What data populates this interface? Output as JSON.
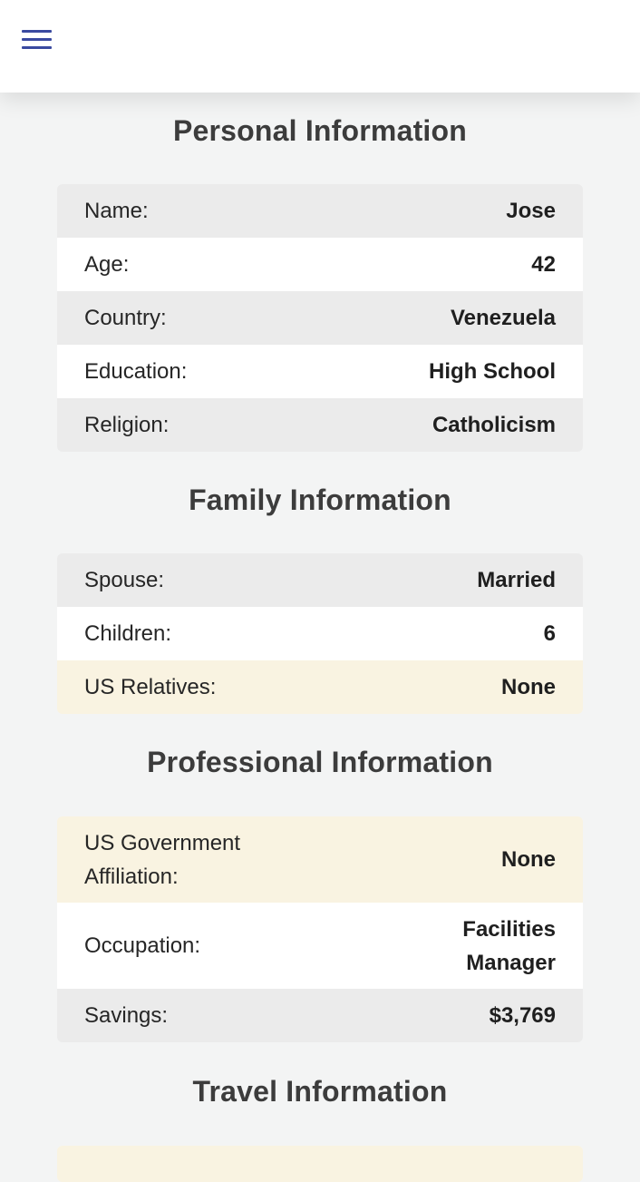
{
  "header": {
    "menu_icon": "hamburger-menu-icon",
    "accent_color": "#3a4aa0"
  },
  "sections": [
    {
      "title": "Personal Information",
      "rows": [
        {
          "label": "Name:",
          "value": "Jose"
        },
        {
          "label": "Age:",
          "value": "42"
        },
        {
          "label": "Country:",
          "value": "Venezuela"
        },
        {
          "label": "Education:",
          "value": "High School"
        },
        {
          "label": "Religion:",
          "value": "Catholicism"
        }
      ]
    },
    {
      "title": "Family Information",
      "rows": [
        {
          "label": "Spouse:",
          "value": "Married"
        },
        {
          "label": "Children:",
          "value": "6"
        },
        {
          "label": "US Relatives:",
          "value": "None"
        }
      ]
    },
    {
      "title": "Professional Information",
      "rows": [
        {
          "label": "US Government Affiliation:",
          "value": "None"
        },
        {
          "label": "Occupation:",
          "value": "Facilities Manager"
        },
        {
          "label": "Savings:",
          "value": "$3,769"
        }
      ]
    },
    {
      "title": "Travel Information",
      "rows": []
    }
  ],
  "colors": {
    "row_gray": "#ebebeb",
    "row_white": "#ffffff",
    "row_highlight": "#f9f3e1",
    "page_background": "#f3f4f4"
  }
}
